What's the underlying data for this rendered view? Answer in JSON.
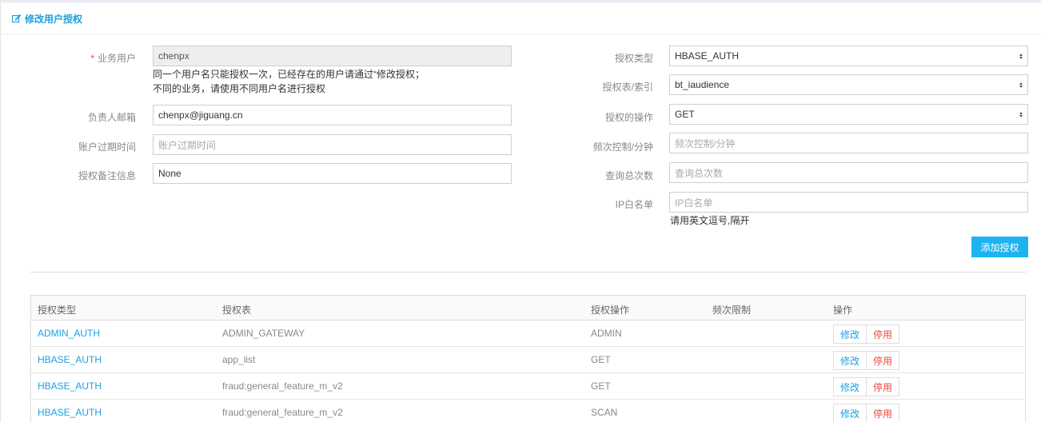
{
  "panel": {
    "title": "修改用户授权",
    "icon": "edit-icon"
  },
  "form_left": {
    "business_user": {
      "label": "业务用户",
      "required_mark": "*",
      "value": "chenpx",
      "help_line1": "同一个用户名只能授权一次，已经存在的用户请通过“修改授权；",
      "help_line2": "不同的业务，请使用不同用户名进行授权"
    },
    "owner_email": {
      "label": "负责人邮箱",
      "value": "chenpx@jiguang.cn"
    },
    "expire_time": {
      "label": "账户过期时间",
      "placeholder": "账户过期时间"
    },
    "remark": {
      "label": "授权备注信息",
      "value": "None"
    }
  },
  "form_right": {
    "auth_type": {
      "label": "授权类型",
      "value": "HBASE_AUTH"
    },
    "auth_table": {
      "label": "授权表/索引",
      "value": "bt_iaudience"
    },
    "auth_op": {
      "label": "授权的操作",
      "value": "GET"
    },
    "rate_limit": {
      "label": "频次控制/分钟",
      "placeholder": "频次控制/分钟"
    },
    "total_queries": {
      "label": "查询总次数",
      "placeholder": "查询总次数"
    },
    "ip_whitelist": {
      "label": "IP白名单",
      "placeholder": "IP白名单",
      "help": "请用英文逗号,隔开"
    },
    "add_button": "添加授权"
  },
  "table": {
    "headers": [
      "授权类型",
      "授权表",
      "授权操作",
      "频次限制",
      "操作"
    ],
    "rows": [
      {
        "type": "ADMIN_AUTH",
        "table": "ADMIN_GATEWAY",
        "op": "ADMIN",
        "limit": "",
        "edit": "修改",
        "stop": "停用"
      },
      {
        "type": "HBASE_AUTH",
        "table": "app_list",
        "op": "GET",
        "limit": "",
        "edit": "修改",
        "stop": "停用"
      },
      {
        "type": "HBASE_AUTH",
        "table": "fraud:general_feature_m_v2",
        "op": "GET",
        "limit": "",
        "edit": "修改",
        "stop": "停用"
      },
      {
        "type": "HBASE_AUTH",
        "table": "fraud:general_feature_m_v2",
        "op": "SCAN",
        "limit": "",
        "edit": "修改",
        "stop": "停用"
      }
    ]
  },
  "colors": {
    "accent": "#1ba1e2",
    "primary_button": "#1cb3f0",
    "danger": "#e84c3d"
  }
}
